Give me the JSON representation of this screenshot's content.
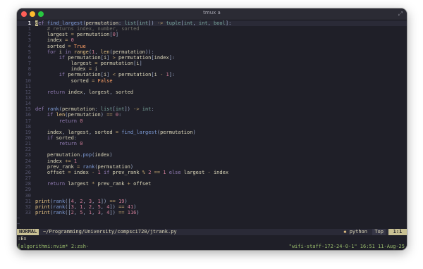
{
  "window": {
    "title": "tmux a"
  },
  "editor": {
    "lines": [
      {
        "n": "1",
        "current": true,
        "tokens": [
          [
            "cursor",
            "d"
          ],
          [
            "kw",
            "ef "
          ],
          [
            "fn",
            "find_largest"
          ],
          [
            "pu",
            "("
          ],
          [
            "",
            "permutation"
          ],
          [
            "pu",
            ": "
          ],
          [
            "ty",
            "list"
          ],
          [
            "pu",
            "["
          ],
          [
            "ty",
            "int"
          ],
          [
            "pu",
            "]) "
          ],
          [
            "op",
            "->"
          ],
          [
            "",
            " "
          ],
          [
            "ty",
            "tuple"
          ],
          [
            "pu",
            "["
          ],
          [
            "ty",
            "int"
          ],
          [
            "pu",
            ", "
          ],
          [
            "ty",
            "int"
          ],
          [
            "pu",
            ", "
          ],
          [
            "ty",
            "bool"
          ],
          [
            "pu",
            "]:"
          ]
        ]
      },
      {
        "n": "1",
        "tokens": [
          [
            "",
            "    "
          ],
          [
            "cm",
            "# returns index, number, sorted"
          ]
        ]
      },
      {
        "n": "2",
        "tokens": [
          [
            "",
            "    largest "
          ],
          [
            "op",
            "="
          ],
          [
            "",
            " permutation"
          ],
          [
            "pu",
            "["
          ],
          [
            "nm",
            "0"
          ],
          [
            "pu",
            "]"
          ]
        ]
      },
      {
        "n": "3",
        "tokens": [
          [
            "",
            "    index "
          ],
          [
            "op",
            "="
          ],
          [
            "",
            " "
          ],
          [
            "nm",
            "0"
          ]
        ]
      },
      {
        "n": "4",
        "tokens": [
          [
            "",
            "    sorted "
          ],
          [
            "op",
            "="
          ],
          [
            "",
            " "
          ],
          [
            "cn",
            "True"
          ]
        ]
      },
      {
        "n": "5",
        "tokens": [
          [
            "",
            "    "
          ],
          [
            "kw",
            "for"
          ],
          [
            "",
            " i "
          ],
          [
            "kw",
            "in"
          ],
          [
            "",
            " "
          ],
          [
            "bi",
            "range"
          ],
          [
            "pu",
            "("
          ],
          [
            "nm",
            "1"
          ],
          [
            "pu",
            ", "
          ],
          [
            "bi",
            "len"
          ],
          [
            "pu",
            "("
          ],
          [
            "",
            "permutation"
          ],
          [
            "pu",
            "))"
          ],
          [
            "pu",
            ":"
          ]
        ]
      },
      {
        "n": "6",
        "tokens": [
          [
            "",
            "        "
          ],
          [
            "kw",
            "if"
          ],
          [
            "",
            " permutation"
          ],
          [
            "pu",
            "["
          ],
          [
            "",
            "i"
          ],
          [
            "pu",
            "] "
          ],
          [
            "op",
            ">"
          ],
          [
            "",
            " permutation"
          ],
          [
            "pu",
            "["
          ],
          [
            "",
            "index"
          ],
          [
            "pu",
            "]:"
          ]
        ]
      },
      {
        "n": "7",
        "tokens": [
          [
            "",
            "            largest "
          ],
          [
            "op",
            "="
          ],
          [
            "",
            " permutation"
          ],
          [
            "pu",
            "["
          ],
          [
            "",
            "i"
          ],
          [
            "pu",
            "]"
          ]
        ]
      },
      {
        "n": "8",
        "tokens": [
          [
            "",
            "            index "
          ],
          [
            "op",
            "="
          ],
          [
            "",
            " i"
          ]
        ]
      },
      {
        "n": "9",
        "tokens": [
          [
            "",
            "        "
          ],
          [
            "kw",
            "if"
          ],
          [
            "",
            " permutation"
          ],
          [
            "pu",
            "["
          ],
          [
            "",
            "i"
          ],
          [
            "pu",
            "] "
          ],
          [
            "op",
            "<"
          ],
          [
            "",
            " permutation"
          ],
          [
            "pu",
            "["
          ],
          [
            "",
            "i "
          ],
          [
            "op",
            "-"
          ],
          [
            "",
            " "
          ],
          [
            "nm",
            "1"
          ],
          [
            "pu",
            "]:"
          ]
        ]
      },
      {
        "n": "10",
        "tokens": [
          [
            "",
            "            sorted "
          ],
          [
            "op",
            "="
          ],
          [
            "",
            " "
          ],
          [
            "cn",
            "False"
          ]
        ]
      },
      {
        "n": "11",
        "tokens": []
      },
      {
        "n": "12",
        "tokens": [
          [
            "",
            "    "
          ],
          [
            "kw",
            "return"
          ],
          [
            "",
            " index"
          ],
          [
            "pu",
            ", "
          ],
          [
            "",
            "largest"
          ],
          [
            "pu",
            ", "
          ],
          [
            "",
            "sorted"
          ]
        ]
      },
      {
        "n": "13",
        "tokens": []
      },
      {
        "n": "14",
        "tokens": []
      },
      {
        "n": "15",
        "tokens": [
          [
            "kw",
            "def "
          ],
          [
            "fn",
            "rank"
          ],
          [
            "pu",
            "("
          ],
          [
            "",
            "permutation"
          ],
          [
            "pu",
            ": "
          ],
          [
            "ty",
            "list"
          ],
          [
            "pu",
            "["
          ],
          [
            "ty",
            "int"
          ],
          [
            "pu",
            "]) "
          ],
          [
            "op",
            "->"
          ],
          [
            "",
            " "
          ],
          [
            "ty",
            "int"
          ],
          [
            "pu",
            ":"
          ]
        ]
      },
      {
        "n": "16",
        "tokens": [
          [
            "",
            "    "
          ],
          [
            "kw",
            "if"
          ],
          [
            "",
            " "
          ],
          [
            "bi",
            "len"
          ],
          [
            "pu",
            "("
          ],
          [
            "",
            "permutation"
          ],
          [
            "pu",
            ") "
          ],
          [
            "op",
            "=="
          ],
          [
            "",
            " "
          ],
          [
            "nm",
            "0"
          ],
          [
            "pu",
            ":"
          ]
        ]
      },
      {
        "n": "17",
        "tokens": [
          [
            "",
            "        "
          ],
          [
            "kw",
            "return"
          ],
          [
            "",
            " "
          ],
          [
            "nm",
            "0"
          ]
        ]
      },
      {
        "n": "18",
        "tokens": []
      },
      {
        "n": "19",
        "tokens": [
          [
            "",
            "    index"
          ],
          [
            "pu",
            ", "
          ],
          [
            "",
            "largest"
          ],
          [
            "pu",
            ", "
          ],
          [
            "",
            "sorted "
          ],
          [
            "op",
            "="
          ],
          [
            "",
            " "
          ],
          [
            "fn",
            "find_largest"
          ],
          [
            "pu",
            "("
          ],
          [
            "",
            "permutation"
          ],
          [
            "pu",
            ")"
          ]
        ]
      },
      {
        "n": "20",
        "tokens": [
          [
            "",
            "    "
          ],
          [
            "kw",
            "if"
          ],
          [
            "",
            " sorted"
          ],
          [
            "pu",
            ":"
          ]
        ]
      },
      {
        "n": "21",
        "tokens": [
          [
            "",
            "        "
          ],
          [
            "kw",
            "return"
          ],
          [
            "",
            " "
          ],
          [
            "nm",
            "0"
          ]
        ]
      },
      {
        "n": "22",
        "tokens": []
      },
      {
        "n": "23",
        "tokens": [
          [
            "",
            "    permutation"
          ],
          [
            "pu",
            "."
          ],
          [
            "fn",
            "pop"
          ],
          [
            "pu",
            "("
          ],
          [
            "",
            "index"
          ],
          [
            "pu",
            ")"
          ]
        ]
      },
      {
        "n": "24",
        "tokens": [
          [
            "",
            "    index "
          ],
          [
            "op",
            "+="
          ],
          [
            "",
            " "
          ],
          [
            "nm",
            "1"
          ]
        ]
      },
      {
        "n": "25",
        "tokens": [
          [
            "",
            "    prev_rank "
          ],
          [
            "op",
            "="
          ],
          [
            "",
            " "
          ],
          [
            "fn",
            "rank"
          ],
          [
            "pu",
            "("
          ],
          [
            "",
            "permutation"
          ],
          [
            "pu",
            ")"
          ]
        ]
      },
      {
        "n": "26",
        "tokens": [
          [
            "",
            "    offset "
          ],
          [
            "op",
            "="
          ],
          [
            "",
            " index "
          ],
          [
            "op",
            "-"
          ],
          [
            "",
            " "
          ],
          [
            "nm",
            "1"
          ],
          [
            "",
            " "
          ],
          [
            "kw",
            "if"
          ],
          [
            "",
            " prev_rank "
          ],
          [
            "op",
            "%"
          ],
          [
            "",
            " "
          ],
          [
            "nm",
            "2"
          ],
          [
            "",
            " "
          ],
          [
            "op",
            "=="
          ],
          [
            "",
            " "
          ],
          [
            "nm",
            "1"
          ],
          [
            "",
            " "
          ],
          [
            "kw",
            "else"
          ],
          [
            "",
            " largest "
          ],
          [
            "op",
            "-"
          ],
          [
            "",
            " index"
          ]
        ]
      },
      {
        "n": "27",
        "tokens": []
      },
      {
        "n": "28",
        "tokens": [
          [
            "",
            "    "
          ],
          [
            "kw",
            "return"
          ],
          [
            "",
            " largest "
          ],
          [
            "op",
            "*"
          ],
          [
            "",
            " prev_rank "
          ],
          [
            "op",
            "+"
          ],
          [
            "",
            " offset"
          ]
        ]
      },
      {
        "n": "29",
        "tokens": []
      },
      {
        "n": "30",
        "tokens": []
      },
      {
        "n": "31",
        "tokens": [
          [
            "bi",
            "print"
          ],
          [
            "pu",
            "("
          ],
          [
            "fn",
            "rank"
          ],
          [
            "pu",
            "(["
          ],
          [
            "nm",
            "4"
          ],
          [
            "pu",
            ", "
          ],
          [
            "nm",
            "2"
          ],
          [
            "pu",
            ", "
          ],
          [
            "nm",
            "3"
          ],
          [
            "pu",
            ", "
          ],
          [
            "nm",
            "1"
          ],
          [
            "pu",
            "]) "
          ],
          [
            "op",
            "=="
          ],
          [
            "",
            " "
          ],
          [
            "nm",
            "19"
          ],
          [
            "pu",
            ")"
          ]
        ]
      },
      {
        "n": "32",
        "tokens": [
          [
            "bi",
            "print"
          ],
          [
            "pu",
            "("
          ],
          [
            "fn",
            "rank"
          ],
          [
            "pu",
            "(["
          ],
          [
            "nm",
            "3"
          ],
          [
            "pu",
            ", "
          ],
          [
            "nm",
            "1"
          ],
          [
            "pu",
            ", "
          ],
          [
            "nm",
            "2"
          ],
          [
            "pu",
            ", "
          ],
          [
            "nm",
            "5"
          ],
          [
            "pu",
            ", "
          ],
          [
            "nm",
            "4"
          ],
          [
            "pu",
            "]) "
          ],
          [
            "op",
            "=="
          ],
          [
            "",
            " "
          ],
          [
            "nm",
            "41"
          ],
          [
            "pu",
            ")"
          ]
        ]
      },
      {
        "n": "33",
        "tokens": [
          [
            "bi",
            "print"
          ],
          [
            "pu",
            "("
          ],
          [
            "fn",
            "rank"
          ],
          [
            "pu",
            "(["
          ],
          [
            "nm",
            "2"
          ],
          [
            "pu",
            ", "
          ],
          [
            "nm",
            "5"
          ],
          [
            "pu",
            ", "
          ],
          [
            "nm",
            "1"
          ],
          [
            "pu",
            ", "
          ],
          [
            "nm",
            "3"
          ],
          [
            "pu",
            ", "
          ],
          [
            "nm",
            "4"
          ],
          [
            "pu",
            "]) "
          ],
          [
            "op",
            "=="
          ],
          [
            "",
            " "
          ],
          [
            "nm",
            "116"
          ],
          [
            "pu",
            ")"
          ]
        ]
      }
    ],
    "empty_lines": [
      "~",
      "~"
    ]
  },
  "statusline": {
    "mode": "NORMAL",
    "path": "~/Programming/University/compsci720/jtrank.py",
    "filetype_icon": "◆",
    "filetype": "python",
    "position": "Top",
    "line_col": "1:1"
  },
  "cmdline": {
    "text": ":Ex"
  },
  "tmux": {
    "left": "[algorithmi:nvim* 2:zsh-",
    "right": "\"wifi-staff-172-24-0-1\" 16:51 11-Aug-25"
  },
  "colors": {
    "background": "#1f1f28",
    "keyword": "#957fb8",
    "function": "#7e9cd8",
    "number": "#d27e99",
    "mode_bg": "#c8c093",
    "tmux_fg": "#98bb6c"
  }
}
